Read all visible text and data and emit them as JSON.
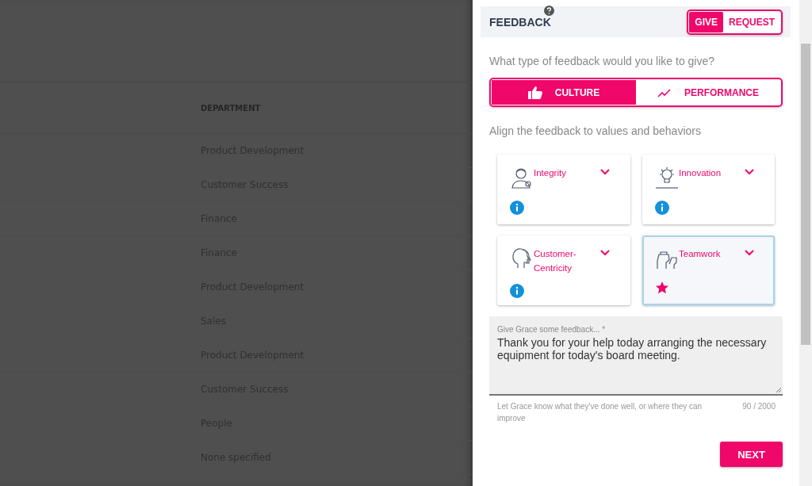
{
  "table": {
    "column_header": "DEPARTMENT",
    "rows": [
      "Product Development",
      "Customer Success",
      "Finance",
      "Finance",
      "Product Development",
      "Sales",
      "Product Development",
      "Customer Success",
      "People",
      "None specified"
    ]
  },
  "panel": {
    "title": "FEEDBACK",
    "mode_tabs": [
      {
        "label": "GIVE",
        "selected": true
      },
      {
        "label": "REQUEST",
        "selected": false
      }
    ],
    "type_question": "What type of feedback would you like to give?",
    "type_tabs": [
      {
        "label": "CULTURE",
        "kind": "thumb",
        "selected": true
      },
      {
        "label": "PERFORMANCE",
        "kind": "trend",
        "selected": false
      }
    ],
    "values_prompt": "Align the feedback to values and behaviors",
    "values": [
      {
        "label": "Integrity",
        "kind": "person",
        "selected": false
      },
      {
        "label": "Innovation",
        "kind": "bulb",
        "selected": false
      },
      {
        "label": "Customer-Centricity",
        "kind": "head",
        "selected": false
      },
      {
        "label": "Teamwork",
        "kind": "fist",
        "selected": true
      }
    ],
    "feedback_field": {
      "label": "Give Grace some feedback... *",
      "value": "Thank you for your help today arranging the necessary equipment for today's board meeting."
    },
    "hint": "Let Grace know what they've done well, or where they can improve",
    "counter": "90 / 2000",
    "next_button": "NEXT"
  }
}
